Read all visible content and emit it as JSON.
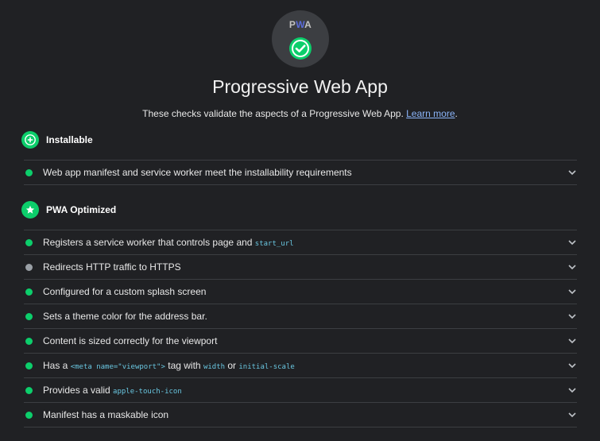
{
  "gauge": {
    "logo_p": "P",
    "logo_w": "W",
    "logo_a": "A",
    "status": "passed"
  },
  "header": {
    "title": "Progressive Web App",
    "description": "These checks validate the aspects of a Progressive Web App.",
    "learn_more": "Learn more",
    "period": "."
  },
  "groups": {
    "installable": {
      "label": "Installable",
      "icon": "plus-icon"
    },
    "optimized": {
      "label": "PWA Optimized",
      "icon": "star-icon"
    }
  },
  "installable_audits": [
    {
      "text": "Web app manifest and service worker meet the installability requirements",
      "status": "pass"
    }
  ],
  "optimized_audits": {
    "a0": {
      "text": "Registers a service worker that controls page and ",
      "code": "start_url",
      "status": "pass"
    },
    "a1": {
      "text": "Redirects HTTP traffic to HTTPS",
      "status": "not-applicable"
    },
    "a2": {
      "text": "Configured for a custom splash screen",
      "status": "pass"
    },
    "a3": {
      "text": "Sets a theme color for the address bar.",
      "status": "pass"
    },
    "a4": {
      "text": "Content is sized correctly for the viewport",
      "status": "pass"
    },
    "a5": {
      "t1": "Has a ",
      "c1": "<meta name=\"viewport\">",
      "t2": " tag with ",
      "c2": "width",
      "t3": " or ",
      "c3": "initial-scale",
      "status": "pass"
    },
    "a6": {
      "text": "Provides a valid ",
      "code": "apple-touch-icon",
      "status": "pass"
    },
    "a7": {
      "text": "Manifest has a maskable icon",
      "status": "pass"
    }
  },
  "colors": {
    "background": "#202124",
    "pass": "#0cce6b",
    "not_applicable": "#9aa0a6",
    "link": "#8ab4f8",
    "code": "#69c6e0"
  }
}
